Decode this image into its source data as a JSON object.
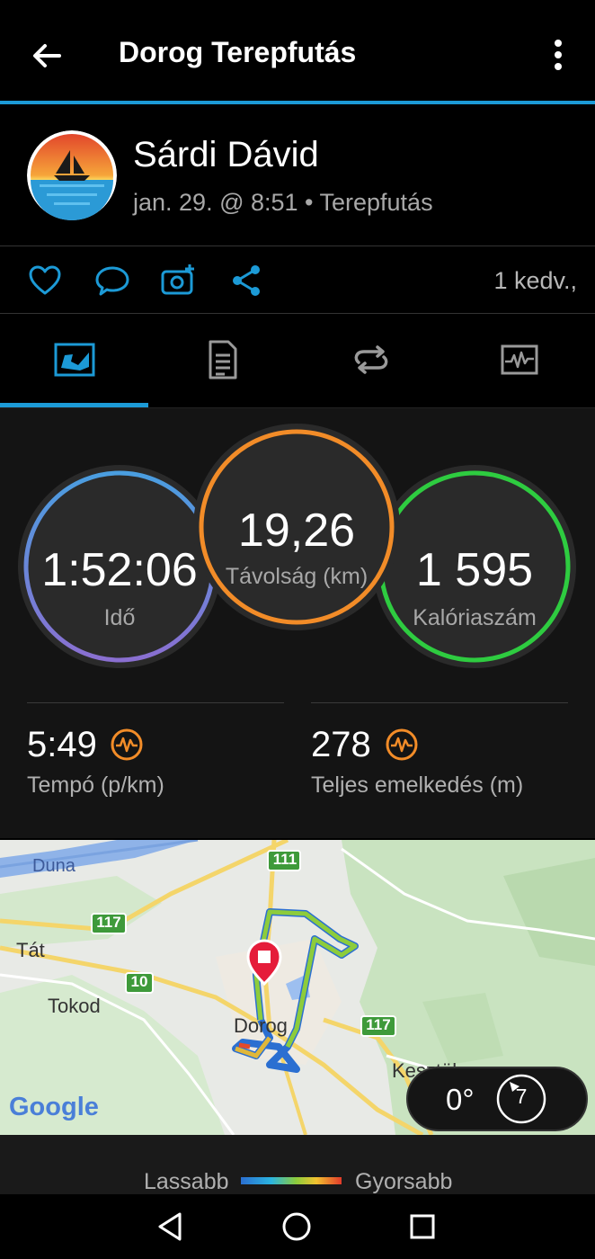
{
  "header": {
    "title": "Dorog Terepfutás"
  },
  "profile": {
    "name": "Sárdi Dávid",
    "meta": "jan. 29. @ 8:51 • Terepfutás"
  },
  "actions": {
    "likes": "1 kedv.,"
  },
  "tabs": [
    {
      "name": "summary",
      "icon": "activity-summary-icon",
      "active": true
    },
    {
      "name": "details",
      "icon": "document-list-icon",
      "active": false
    },
    {
      "name": "laps",
      "icon": "loop-arrows-icon",
      "active": false
    },
    {
      "name": "charts",
      "icon": "chart-icon",
      "active": false
    }
  ],
  "stats": {
    "time_value": "1:52:06",
    "time_label": "Idő",
    "distance_value": "19,26",
    "distance_label": "Távolság (km)",
    "calories_value": "1 595",
    "calories_label": "Kalóriaszám",
    "pace_value": "5:49",
    "pace_label": "Tempó (p/km)",
    "elevation_value": "278",
    "elevation_label": "Teljes emelkedés (m)"
  },
  "map": {
    "labels": {
      "duna": "Duna",
      "tat": "Tát",
      "tokod": "Tokod",
      "dorog": "Dorog",
      "kesztolc": "Kesztölc",
      "road_111": "111",
      "road_117a": "117",
      "road_117b": "117",
      "road_10": "10",
      "google": "Google"
    },
    "compass_angle": "0°",
    "compass_value": "7"
  },
  "legend": {
    "slower": "Lassabb",
    "faster": "Gyorsabb"
  },
  "colors": {
    "accent": "#1c9ad6",
    "time_ring": "#4a90d9",
    "distance_ring": "#f28c28",
    "calories_ring": "#2ecc40"
  }
}
